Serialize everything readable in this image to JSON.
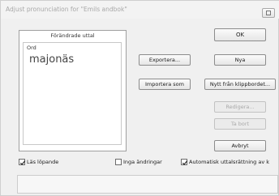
{
  "window": {
    "title": "Adjust pronunciation for \"Emils andbok\""
  },
  "panel": {
    "header": "Förändrade uttal",
    "column_label": "Ord",
    "word": "majonäs"
  },
  "buttons": {
    "ok": "OK",
    "new": "Nya",
    "new_from_clipboard": "Nytt från klippbordet...",
    "edit": "Redigera...",
    "delete": "Ta bort",
    "cancel": "Avbryt",
    "export": "Exportera...",
    "import": "Importera som"
  },
  "checkboxes": {
    "read_continuous": {
      "label": "Läs löpande",
      "checked": true
    },
    "no_changes": {
      "label": "Inga ändringar",
      "checked": false
    },
    "auto_correction": {
      "label": "Automatisk uttalsrättning av k",
      "checked": true
    }
  }
}
